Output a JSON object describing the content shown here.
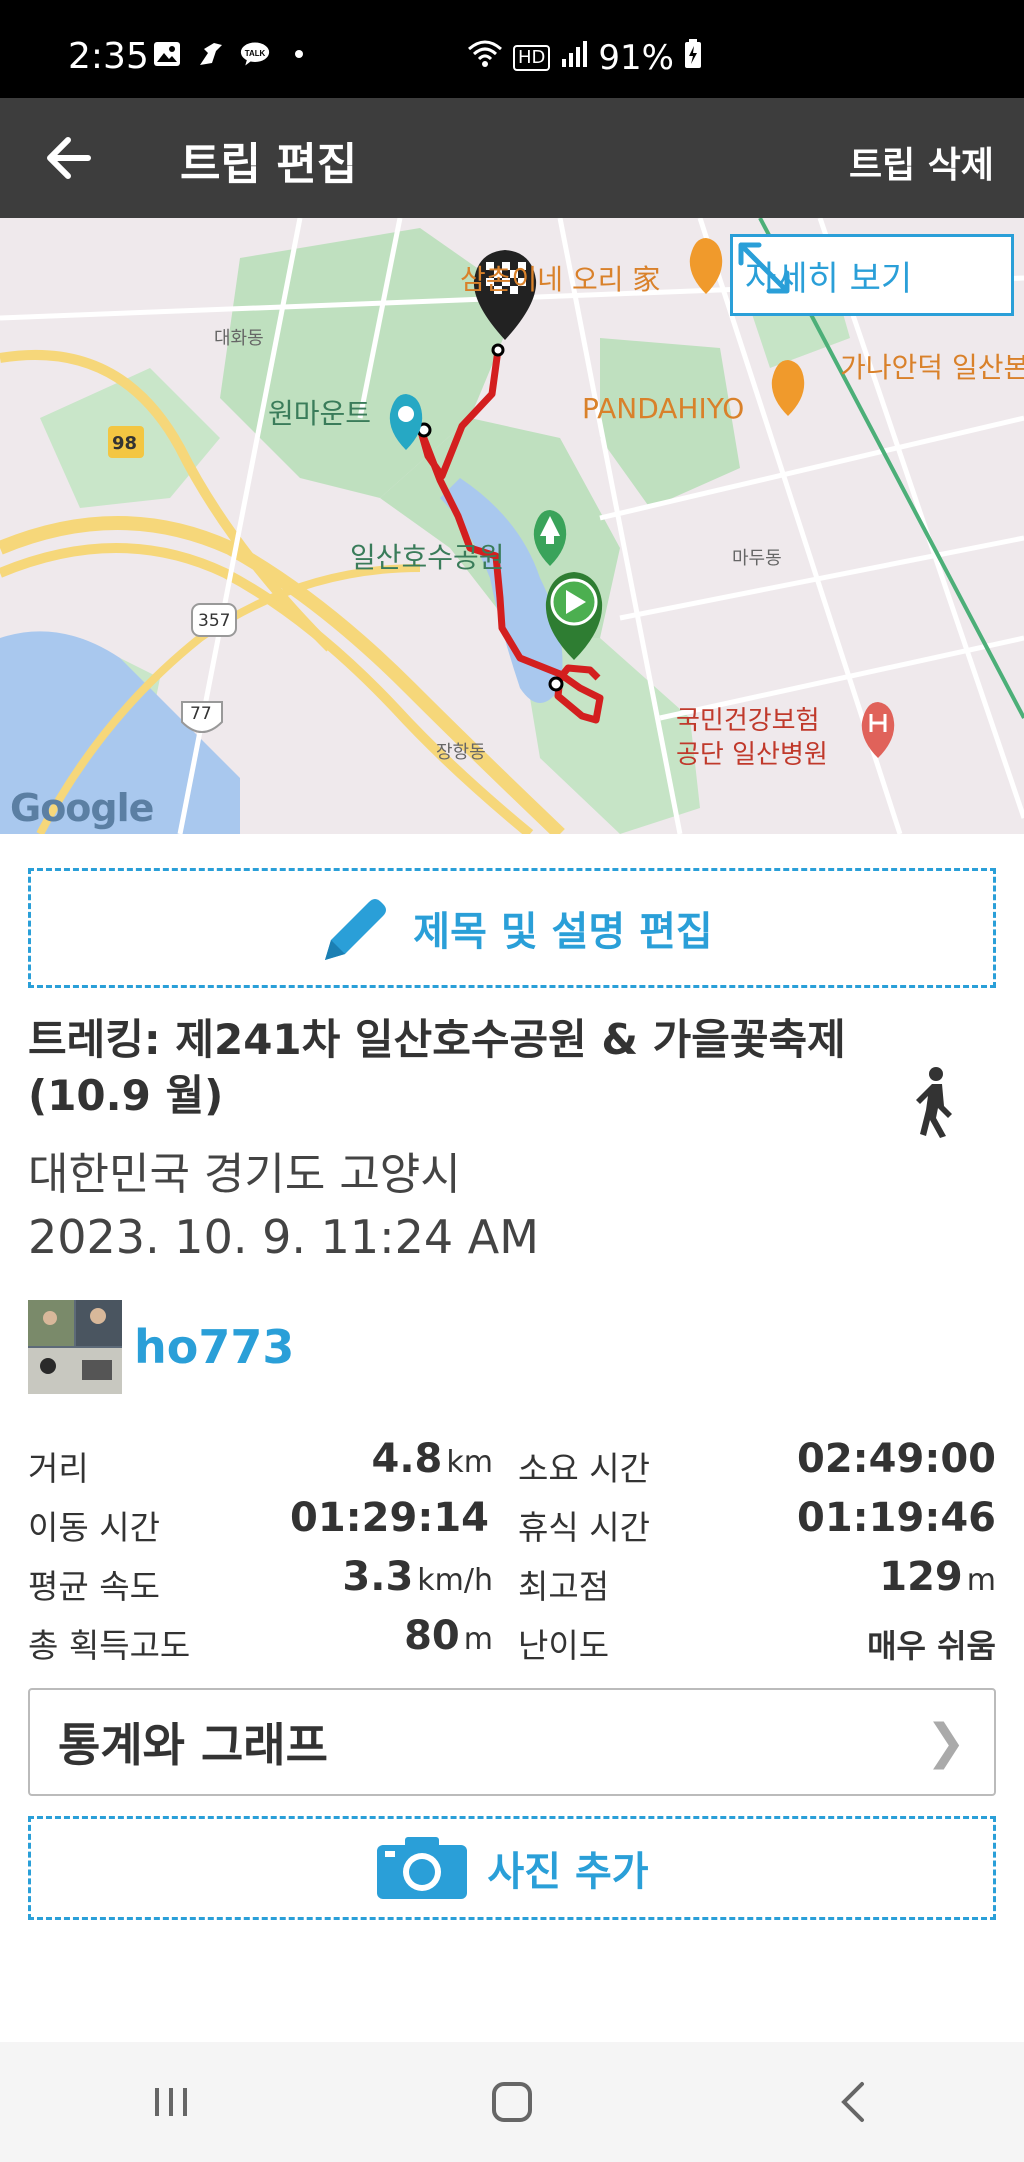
{
  "status_bar": {
    "time": "2:35",
    "battery": "91%",
    "network_badge": "HD",
    "icons": [
      "gallery-icon",
      "bird-icon",
      "talk-icon",
      "dot-icon",
      "wifi-icon",
      "signal-icon",
      "battery-icon"
    ],
    "talk_label": "TALK"
  },
  "toolbar": {
    "title": "트립 편집",
    "delete_label": "트립 삭제"
  },
  "map": {
    "detail_label": "자세히 보기",
    "google_logo": "Google",
    "labels": {
      "restaurant1": "삼촌이네 오리 家",
      "restaurant2": "PANDAHIYO",
      "restaurant3": "가나안덕 일산본",
      "onemount": "원마운트",
      "park": "일산호수공원",
      "hospital": "국민건강보험\n공단 일산병원",
      "dong1": "대화동",
      "dong2": "마두동",
      "dong3": "장항동",
      "road98": "98",
      "road357": "357",
      "road77": "77"
    },
    "colors": {
      "route": "#d31f1f",
      "water": "#a9c8ee",
      "park": "#b9dcb9",
      "road": "#f6d77a"
    }
  },
  "edit_button_label": "제목 및 설명 편집",
  "trip": {
    "title": "트레킹: 제241차 일산호수공원 & 가을꽃축제(10.9 월)",
    "location": "대한민국 경기도 고양시",
    "datetime": "2023. 10. 9. 11:24 AM",
    "activity_icon": "walking-icon"
  },
  "user": {
    "name": "ho773"
  },
  "stats": [
    {
      "label": "거리",
      "value": "4.8",
      "unit": "km",
      "label2": "소요 시간",
      "value2": "02:49:00",
      "unit2": ""
    },
    {
      "label": "이동 시간",
      "value": "01:29:14",
      "unit": "",
      "label2": "휴식 시간",
      "value2": "01:19:46",
      "unit2": ""
    },
    {
      "label": "평균 속도",
      "value": "3.3",
      "unit": "km/h",
      "label2": "최고점",
      "value2": "129",
      "unit2": "m"
    },
    {
      "label": "총 획득고도",
      "value": "80",
      "unit": "m",
      "label2": "난이도",
      "value2": "매우 쉬움",
      "unit2": ""
    }
  ],
  "graph_label": "통계와 그래프",
  "graph_chevron": "❯",
  "photo_button_label": "사진 추가",
  "accent_color": "#2a9fd8"
}
